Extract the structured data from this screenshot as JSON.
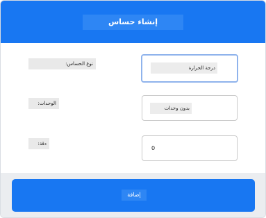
{
  "dialog": {
    "title": "إنشاء حساس",
    "colors": {
      "header": "#1877f2",
      "button": "#1877f2",
      "footer": "#ebedf0",
      "focus_border": "#8fb3ec"
    }
  },
  "fields": {
    "sensor_type": {
      "label": "نوع الحساس:",
      "value": "درجة الحرارة"
    },
    "units": {
      "label": "الوحدات:",
      "value": "بدون وحدات"
    },
    "decimals": {
      "label": "دقة:",
      "value": "0"
    }
  },
  "footer": {
    "add_label": "إضافة"
  }
}
